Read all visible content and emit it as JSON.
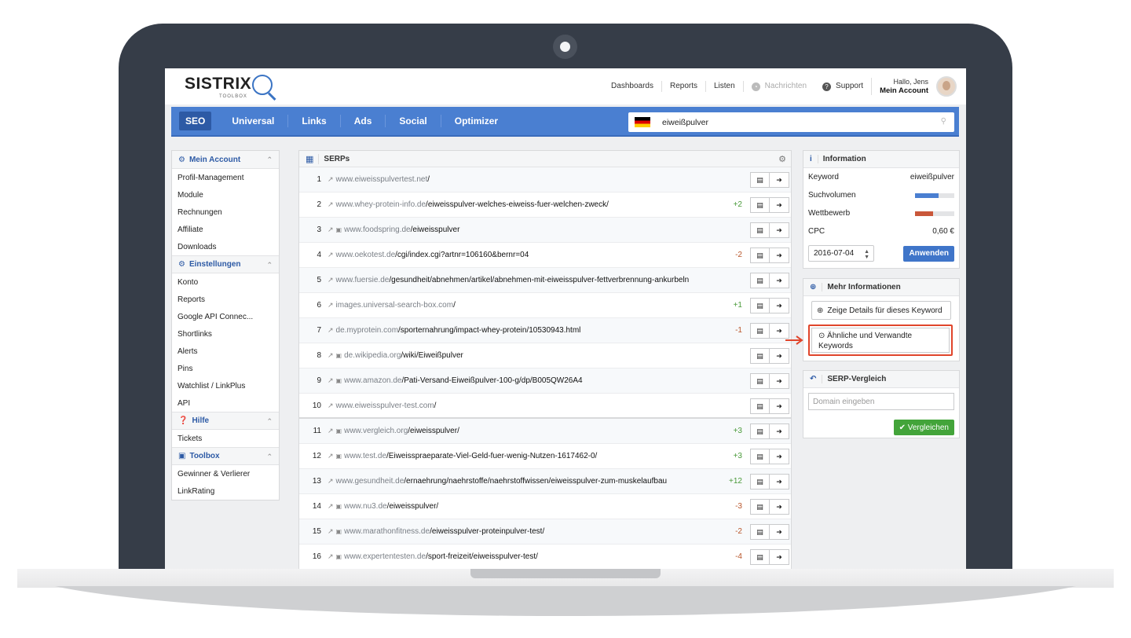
{
  "brand": {
    "logo": "SISTRIX",
    "sub": "TOOLBOX"
  },
  "topnav": {
    "links": [
      "Dashboards",
      "Reports",
      "Listen"
    ],
    "nachrichten": "Nachrichten",
    "support": "Support",
    "greeting": "Hallo, Jens",
    "account": "Mein Account"
  },
  "mainnav": {
    "tabs": [
      "SEO",
      "Universal",
      "Links",
      "Ads",
      "Social",
      "Optimizer"
    ],
    "search_value": "eiweißpulver"
  },
  "sidebar": {
    "sections": [
      {
        "title": "Mein Account",
        "items": [
          "Profil-Management",
          "Module",
          "Rechnungen",
          "Affiliate",
          "Downloads"
        ]
      },
      {
        "title": "Einstellungen",
        "items": [
          "Konto",
          "Reports",
          "Google API Connec...",
          "Shortlinks",
          "Alerts",
          "Pins",
          "Watchlist / LinkPlus",
          "API"
        ]
      },
      {
        "title": "Hilfe",
        "items": [
          "Tickets"
        ]
      },
      {
        "title": "Toolbox",
        "items": [
          "Gewinner & Verlierer",
          "LinkRating"
        ]
      }
    ]
  },
  "serps": {
    "title": "SERPs",
    "rows": [
      {
        "rank": "1",
        "lock": false,
        "domain": "www.eiweisspulvertest.net",
        "path": "/",
        "change": ""
      },
      {
        "rank": "2",
        "lock": false,
        "domain": "www.whey-protein-info.de",
        "path": "/eiweisspulver-welches-eiweiss-fuer-welchen-zweck/",
        "change": "+2"
      },
      {
        "rank": "3",
        "lock": true,
        "domain": "www.foodspring.de",
        "path": "/eiweisspulver",
        "change": ""
      },
      {
        "rank": "4",
        "lock": false,
        "domain": "www.oekotest.de",
        "path": "/cgi/index.cgi?artnr=106160&bernr=04",
        "change": "-2"
      },
      {
        "rank": "5",
        "lock": false,
        "domain": "www.fuersie.de",
        "path": "/gesundheit/abnehmen/artikel/abnehmen-mit-eiweisspulver-fettverbrennung-ankurbeln",
        "change": ""
      },
      {
        "rank": "6",
        "lock": false,
        "domain": "images.universal-search-box.com",
        "path": "/",
        "change": "+1"
      },
      {
        "rank": "7",
        "lock": false,
        "domain": "de.myprotein.com",
        "path": "/sporternahrung/impact-whey-protein/10530943.html",
        "change": "-1"
      },
      {
        "rank": "8",
        "lock": true,
        "domain": "de.wikipedia.org",
        "path": "/wiki/Eiweißpulver",
        "change": ""
      },
      {
        "rank": "9",
        "lock": true,
        "domain": "www.amazon.de",
        "path": "/Pati-Versand-Eiweißpulver-100-g/dp/B005QW26A4",
        "change": ""
      },
      {
        "rank": "10",
        "lock": false,
        "domain": "www.eiweisspulver-test.com",
        "path": "/",
        "change": ""
      },
      {
        "rank": "11",
        "lock": true,
        "domain": "www.vergleich.org",
        "path": "/eiweisspulver/",
        "change": "+3"
      },
      {
        "rank": "12",
        "lock": true,
        "domain": "www.test.de",
        "path": "/Eiweisspraeparate-Viel-Geld-fuer-wenig-Nutzen-1617462-0/",
        "change": "+3"
      },
      {
        "rank": "13",
        "lock": false,
        "domain": "www.gesundheit.de",
        "path": "/ernaehrung/naehrstoffe/naehrstoffwissen/eiweisspulver-zum-muskelaufbau",
        "change": "+12"
      },
      {
        "rank": "14",
        "lock": true,
        "domain": "www.nu3.de",
        "path": "/eiweisspulver/",
        "change": "-3"
      },
      {
        "rank": "15",
        "lock": true,
        "domain": "www.marathonfitness.de",
        "path": "/eiweisspulver-proteinpulver-test/",
        "change": "-2"
      },
      {
        "rank": "16",
        "lock": true,
        "domain": "www.expertentesten.de",
        "path": "/sport-freizeit/eiweisspulver-test/",
        "change": "-4"
      }
    ]
  },
  "info": {
    "title": "Information",
    "keyword_label": "Keyword",
    "keyword_value": "eiweißpulver",
    "volume_label": "Suchvolumen",
    "volume_level": 0.6,
    "volume_color": "#4a7fd1",
    "competition_label": "Wettbewerb",
    "competition_level": 0.45,
    "competition_color": "#c9573a",
    "cpc_label": "CPC",
    "cpc_value": "0,60 €",
    "date": "2016-07-04",
    "apply": "Anwenden"
  },
  "more": {
    "title": "Mehr Informationen",
    "details_button": "Zeige Details für dieses Keyword",
    "similar_line1": "Ähnliche und Verwandte",
    "similar_line2": "Keywords"
  },
  "compare": {
    "title": "SERP-Vergleich",
    "placeholder": "Domain eingeben",
    "button": "Vergleichen"
  }
}
